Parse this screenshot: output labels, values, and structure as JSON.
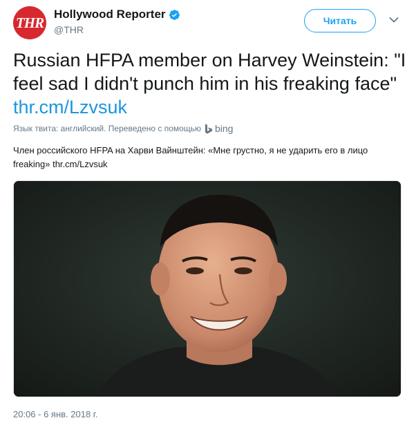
{
  "author": {
    "name": "Hollywood Reporter",
    "handle": "@THR",
    "avatar_text": "THR",
    "verified": true,
    "avatar_color": "#d8282f"
  },
  "follow_button": {
    "label": "Читать"
  },
  "menu": {
    "icon": "chevron-down-icon"
  },
  "tweet": {
    "text": "Russian HFPA member on Harvey Weinstein: \"I feel sad I didn't punch him in his freaking face\"",
    "link": "thr.cm/Lzvsuk"
  },
  "translation": {
    "note": "Язык твита: английский. Переведено с помощью",
    "provider": "bing",
    "text": "Член российского HFPA на Харви Вайнштейн: «Мне грустно, я не ударить его в лицо freaking» thr.cm/Lzvsuk"
  },
  "media": {
    "icon": "photo-portrait"
  },
  "timestamp": "20:06 - 6 янв. 2018 г.",
  "colors": {
    "accent": "#1da1f2",
    "link": "#1b95e0",
    "secondary_text": "#657786"
  }
}
